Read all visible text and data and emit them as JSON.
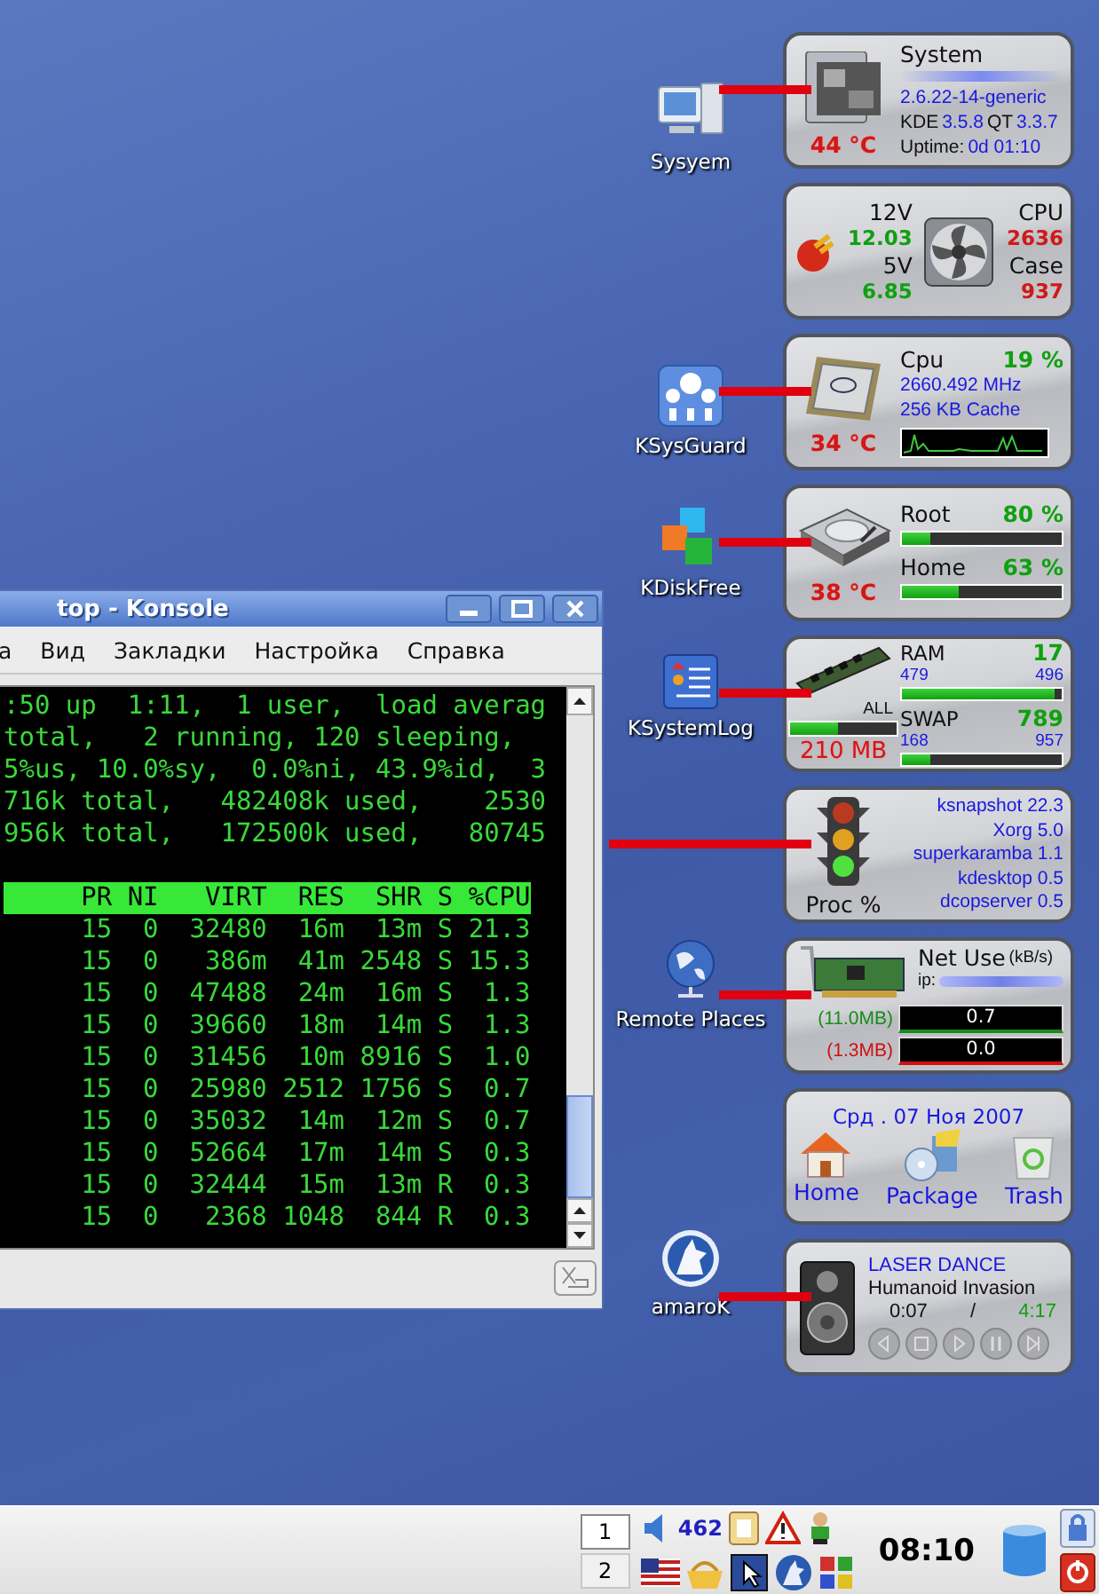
{
  "konsole": {
    "title": "top - Konsole",
    "menu": [
      {
        "label": "а"
      },
      {
        "label": "Вид"
      },
      {
        "label": "Закладки"
      },
      {
        "label": "Настройка"
      },
      {
        "label": "Справка"
      }
    ],
    "summary": [
      ":50 up  1:11,  1 user,  load averag",
      "total,   2 running, 120 sleeping,",
      "5%us, 10.0%sy,  0.0%ni, 43.9%id,  3",
      "716k total,   482408k used,    2530",
      "956k total,   172500k used,   80745"
    ],
    "columns": [
      "PR",
      "NI",
      "VIRT",
      "RES",
      "SHR",
      "S",
      "%CPU"
    ],
    "rows": [
      [
        "15",
        "0",
        "32480",
        "16m",
        "13m",
        "S",
        "21.3"
      ],
      [
        "15",
        "0",
        "386m",
        "41m",
        "2548",
        "S",
        "15.3"
      ],
      [
        "15",
        "0",
        "47488",
        "24m",
        "16m",
        "S",
        "1.3"
      ],
      [
        "15",
        "0",
        "39660",
        "18m",
        "14m",
        "S",
        "1.3"
      ],
      [
        "15",
        "0",
        "31456",
        "10m",
        "8916",
        "S",
        "1.0"
      ],
      [
        "15",
        "0",
        "25980",
        "2512",
        "1756",
        "S",
        "0.7"
      ],
      [
        "15",
        "0",
        "35032",
        "14m",
        "12m",
        "S",
        "0.7"
      ],
      [
        "15",
        "0",
        "52664",
        "17m",
        "14m",
        "S",
        "0.3"
      ],
      [
        "15",
        "0",
        "32444",
        "15m",
        "13m",
        "R",
        "0.3"
      ],
      [
        "15",
        "0",
        "2368",
        "1048",
        "844",
        "R",
        "0.3"
      ]
    ]
  },
  "desktop_icons": [
    {
      "kind": "computer",
      "label": "Sysyem"
    },
    {
      "kind": "monitor",
      "label": "KSysGuard"
    },
    {
      "kind": "cubes",
      "label": "KDiskFree"
    },
    {
      "kind": "log",
      "label": "KSystemLog"
    },
    {
      "kind": "globe",
      "label": "Remote Places"
    },
    {
      "kind": "wolf",
      "label": "amaroK"
    }
  ],
  "widgets": [
    {
      "kind": "system",
      "linked": true,
      "temp": "44 °C",
      "title": "System",
      "kernel": "2.6.22-14-generic",
      "kde_label": "KDE",
      "kde_version": "3.5.8",
      "qt_label": "QT",
      "qt_version": "3.3.7",
      "uptime_label": "Uptime:",
      "uptime": "0d 01:10"
    },
    {
      "kind": "sensors",
      "linked": false,
      "v12_label": "12V",
      "v12": "12.03",
      "v5_label": "5V",
      "v5": "6.85",
      "cpu_label": "CPU",
      "cpu": "2636",
      "case_label": "Case",
      "case": "937"
    },
    {
      "kind": "cpu",
      "linked": true,
      "title": "Cpu",
      "load": "19 %",
      "freq": "2660.492  MHz",
      "cache": "256 KB Cache",
      "temp": "34 °C"
    },
    {
      "kind": "disk",
      "linked": true,
      "temp": "38 °C",
      "mounts": [
        {
          "label": "Root",
          "value": "80 %",
          "level": 0.18
        },
        {
          "label": "Home",
          "value": "63 %",
          "level": 0.35
        }
      ]
    },
    {
      "kind": "ram",
      "linked": true,
      "all": {
        "label": "ALL",
        "level": 0.45
      },
      "total": "210 MB",
      "mems": [
        {
          "label": "RAM",
          "value": "17",
          "used": "479",
          "size": "496",
          "level": 0.96
        },
        {
          "label": "SWAP",
          "value": "789",
          "used": "168",
          "size": "957",
          "level": 0.18
        }
      ]
    },
    {
      "kind": "proc",
      "linked": true,
      "title": "Proc %",
      "procs": [
        "ksnapshot 22.3",
        "Xorg 5.0",
        "superkaramba 1.1",
        "kdesktop 0.5",
        "dcopserver 0.5"
      ]
    },
    {
      "kind": "net",
      "linked": true,
      "title": "Net Use",
      "unit": "(kB/s)",
      "ip_label": "ip:",
      "rows": [
        {
          "total": "(11.0MB)",
          "rate": "0.7",
          "color": "#1a8a1a"
        },
        {
          "total": "(1.3MB)",
          "rate": "0.0",
          "color": "#d01010"
        }
      ]
    },
    {
      "kind": "date",
      "linked": false,
      "date": "Срд . 07 Ноя 2007",
      "launchers": [
        {
          "kind": "home",
          "label": "Home"
        },
        {
          "kind": "package",
          "label": "Package"
        },
        {
          "kind": "trash",
          "label": "Trash"
        }
      ]
    },
    {
      "kind": "player",
      "linked": true,
      "artist": "LASER DANCE",
      "track": "Humanoid Invasion",
      "elapsed": "0:07",
      "separator": "/",
      "length": "4:17",
      "controls": [
        {
          "kind": "prev"
        },
        {
          "kind": "stop"
        },
        {
          "kind": "play"
        },
        {
          "kind": "pause"
        },
        {
          "kind": "next"
        }
      ]
    }
  ],
  "taskbar": {
    "desktops": [
      {
        "label": "1",
        "selected": true
      },
      {
        "label": "2",
        "selected": false
      }
    ],
    "mail_count": "462",
    "clock": "08:10"
  }
}
